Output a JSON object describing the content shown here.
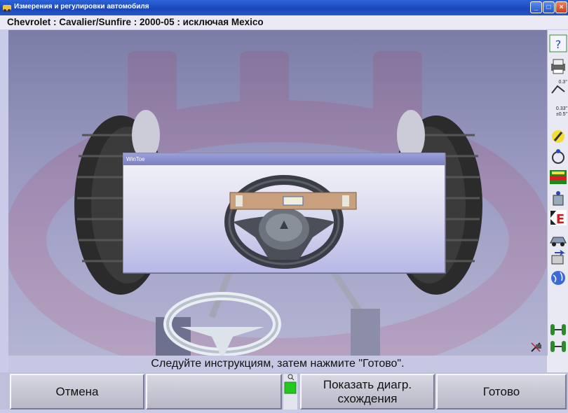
{
  "window": {
    "title": "Измерения и регулировки автомобиля"
  },
  "vehicle": {
    "header": "Chevrolet : Cavalier/Sunfire : 2000-05 : исключая Mexico"
  },
  "dialog": {
    "title": "WinToe"
  },
  "toolbar": {
    "tools": [
      {
        "icon": "help-icon"
      },
      {
        "icon": "printer-icon"
      },
      {
        "icon": "tolerance-icon",
        "label": "0.3°"
      },
      {
        "icon": "tolerance-range-icon",
        "label": "0.33\" ±0.5\""
      },
      {
        "icon": "wrench-icon"
      },
      {
        "icon": "runout-icon"
      },
      {
        "icon": "readings-icon"
      },
      {
        "icon": "sensor-icon"
      },
      {
        "icon": "e-icon"
      },
      {
        "icon": "car-icon"
      },
      {
        "icon": "swap-icon"
      },
      {
        "icon": "globe-icon"
      }
    ]
  },
  "status": {
    "instruction": "Следуйте инструкциям, затем нажмите \"Готово\"."
  },
  "buttons": {
    "cancel": "Отмена",
    "blank": "",
    "show_toe_diagram": "Показать диагр.\nсхождения",
    "done": "Готово"
  },
  "colors": {
    "accent": "#c01a3a",
    "titlebar": "#1f4fc4",
    "indicator": "#22c81e"
  }
}
